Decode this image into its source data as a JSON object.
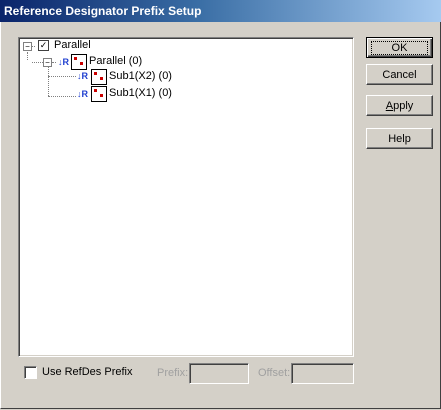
{
  "window": {
    "title": "Reference Designator Prefix Setup"
  },
  "tree": {
    "root": {
      "label": "Parallel",
      "expander": "−",
      "checked": "✓"
    },
    "child": {
      "label": "Parallel (0)",
      "expander": "−"
    },
    "leaves": [
      {
        "label": "Sub1(X2) (0)"
      },
      {
        "label": "Sub1(X1) (0)"
      }
    ],
    "ref_arrow": "↓R"
  },
  "buttons": {
    "ok": "OK",
    "cancel": "Cancel",
    "apply": "Apply",
    "help": "Help"
  },
  "options": {
    "use_refdes_label": "Use RefDes Prefix",
    "prefix_label": "Prefix:",
    "prefix_value": "",
    "offset_label": "Offset:",
    "offset_value": ""
  }
}
